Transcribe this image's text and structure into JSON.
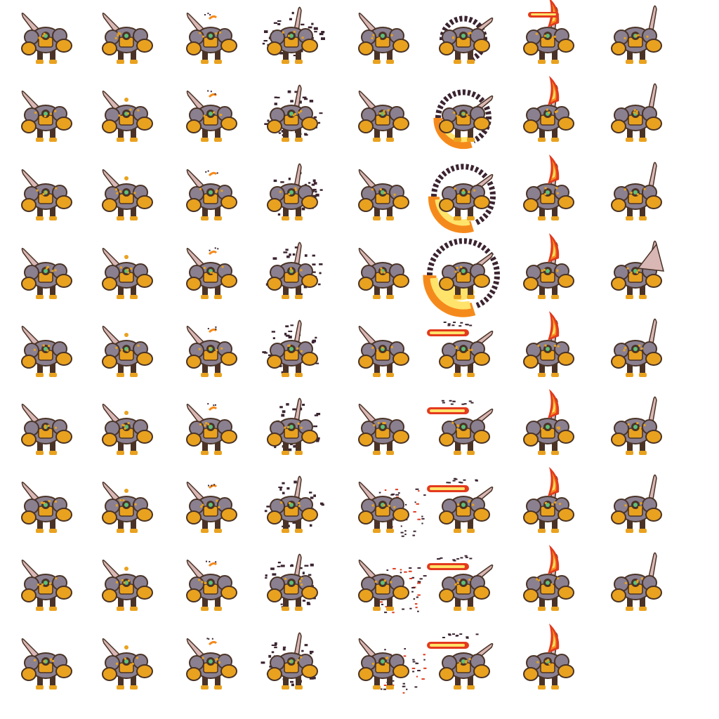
{
  "sprite_sheet": {
    "columns": 8,
    "rows": 9,
    "frame_counts_per_column": [
      9,
      9,
      9,
      9,
      9,
      9,
      9,
      8
    ],
    "animations": [
      {
        "effect": "idle",
        "weapon": "blade-back"
      },
      {
        "effect": "idle-spark",
        "weapon": "blade-back"
      },
      {
        "effect": "charge-spark",
        "weapon": "blade-back"
      },
      {
        "effect": "debris-burst",
        "weapon": "blade-raised"
      },
      {
        "effect": "dust-scatter",
        "weapon": "blade-back"
      },
      {
        "effect": "fire-swirl",
        "weapon": "blade-swing"
      },
      {
        "effect": "fire-pillar",
        "weapon": "blade-raised"
      },
      {
        "effect": "recover",
        "weapon": "blade-up"
      }
    ],
    "palette": {
      "background": "#ffffff",
      "armor_gold": "#e9a21f",
      "armor_dark": "#4a3326",
      "stone_gray": "#8a8090",
      "blade_pink": "#d9b7b5",
      "fire_red": "#e33a1d",
      "fire_orange": "#f58a1c",
      "fire_yellow": "#ffe36b",
      "debris_dark": "#3b2430",
      "core_green": "#5fbf7a"
    }
  }
}
